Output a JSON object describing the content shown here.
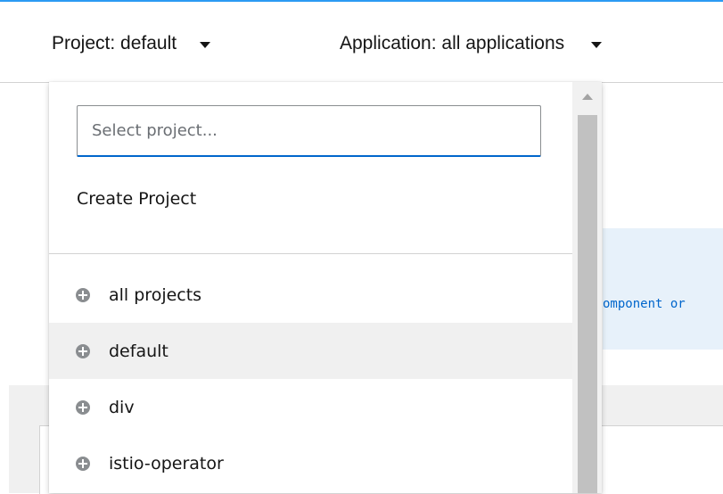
{
  "toolbar": {
    "project_label": "Project: default",
    "application_label": "Application: all applications"
  },
  "background": {
    "alert_text_fragment": "omponent or"
  },
  "dropdown": {
    "search": {
      "value": "",
      "placeholder": "Select project..."
    },
    "create_project_label": "Create Project",
    "selected_project": "default",
    "projects": [
      {
        "label": "all projects",
        "icon": "plus-circle-icon"
      },
      {
        "label": "default",
        "icon": "plus-circle-icon"
      },
      {
        "label": "div",
        "icon": "plus-circle-icon"
      },
      {
        "label": "istio-operator",
        "icon": "plus-circle-icon"
      }
    ]
  },
  "colors": {
    "accent": "#0066cc",
    "top_border": "#2b9af3",
    "selected_row": "#f0f0f0",
    "alert_background": "#e7f1fa"
  }
}
